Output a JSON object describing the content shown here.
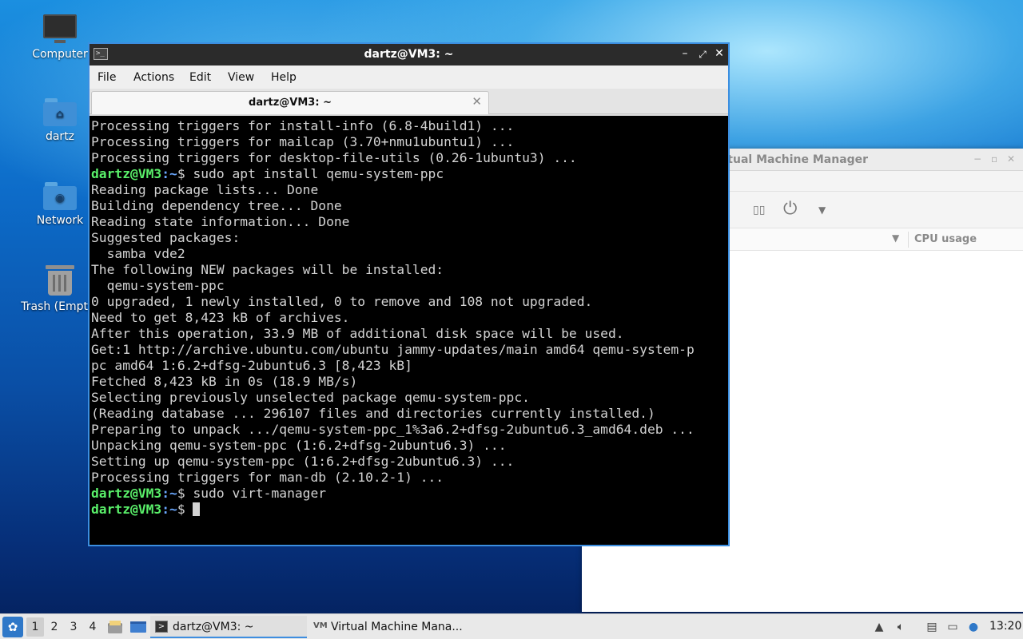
{
  "desktop": {
    "icons": [
      {
        "label": "Computer"
      },
      {
        "label": "dartz"
      },
      {
        "label": "Network"
      },
      {
        "label": "Trash (Empty)"
      }
    ]
  },
  "virt_manager": {
    "title": "Virtual Machine Manager",
    "column_cpu": "CPU usage"
  },
  "terminal": {
    "title": "dartz@VM3: ~",
    "menu": [
      "File",
      "Actions",
      "Edit",
      "View",
      "Help"
    ],
    "tab_label": "dartz@VM3: ~",
    "prompt_user": "dartz@VM3",
    "prompt_path": ":~",
    "prompt_sign": "$ ",
    "lines": [
      {
        "text": "Processing triggers for install-info (6.8-4build1) ..."
      },
      {
        "text": "Processing triggers for mailcap (3.70+nmu1ubuntu1) ..."
      },
      {
        "text": "Processing triggers for desktop-file-utils (0.26-1ubuntu3) ..."
      },
      {
        "prompt": true,
        "text": "sudo apt install qemu-system-ppc"
      },
      {
        "text": "Reading package lists... Done"
      },
      {
        "text": "Building dependency tree... Done"
      },
      {
        "text": "Reading state information... Done"
      },
      {
        "text": "Suggested packages:"
      },
      {
        "text": "  samba vde2"
      },
      {
        "text": "The following NEW packages will be installed:"
      },
      {
        "text": "  qemu-system-ppc"
      },
      {
        "text": "0 upgraded, 1 newly installed, 0 to remove and 108 not upgraded."
      },
      {
        "text": "Need to get 8,423 kB of archives."
      },
      {
        "text": "After this operation, 33.9 MB of additional disk space will be used."
      },
      {
        "text": "Get:1 http://archive.ubuntu.com/ubuntu jammy-updates/main amd64 qemu-system-p"
      },
      {
        "text": "pc amd64 1:6.2+dfsg-2ubuntu6.3 [8,423 kB]"
      },
      {
        "text": "Fetched 8,423 kB in 0s (18.9 MB/s)"
      },
      {
        "text": "Selecting previously unselected package qemu-system-ppc."
      },
      {
        "text": "(Reading database ... 296107 files and directories currently installed.)"
      },
      {
        "text": "Preparing to unpack .../qemu-system-ppc_1%3a6.2+dfsg-2ubuntu6.3_amd64.deb ..."
      },
      {
        "text": "Unpacking qemu-system-ppc (1:6.2+dfsg-2ubuntu6.3) ..."
      },
      {
        "text": "Setting up qemu-system-ppc (1:6.2+dfsg-2ubuntu6.3) ..."
      },
      {
        "text": "Processing triggers for man-db (2.10.2-1) ..."
      },
      {
        "prompt": true,
        "text": "sudo virt-manager"
      },
      {
        "prompt": true,
        "text": "",
        "cursor": true
      }
    ]
  },
  "taskbar": {
    "workspaces": [
      "1",
      "2",
      "3",
      "4"
    ],
    "active_workspace": "1",
    "tasks": [
      {
        "label": "dartz@VM3: ~",
        "active": true
      },
      {
        "label": "Virtual Machine Mana...",
        "active": false
      }
    ],
    "clock": "13:20"
  }
}
